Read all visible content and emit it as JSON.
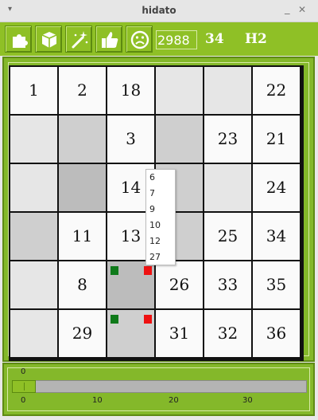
{
  "window": {
    "title": "hidato",
    "menu_glyph": "▾",
    "minimize_glyph": "_",
    "close_glyph": "✕"
  },
  "toolbar": {
    "buttons": [
      {
        "name": "puzzle-button",
        "icon": "puzzle-icon"
      },
      {
        "name": "cube-button",
        "icon": "cube-icon"
      },
      {
        "name": "magic-wand-button",
        "icon": "magic-wand-icon"
      },
      {
        "name": "thumbs-up-button",
        "icon": "thumbs-up-icon"
      },
      {
        "name": "sad-face-button",
        "icon": "sad-face-icon"
      }
    ],
    "score": "2988",
    "count": "34",
    "level": "H2"
  },
  "colors": {
    "accent": "#8fc026",
    "border_dark": "#5e8a14",
    "cell_white": "#fafafa",
    "cell_light": "#e6e6e6",
    "cell_mid": "#cfcfcf",
    "cell_dark": "#bcbcbc",
    "marker_green": "#0f7a1a",
    "marker_red": "#ee1111"
  },
  "grid": {
    "rows": [
      [
        {
          "v": "1",
          "shade": "white"
        },
        {
          "v": "2",
          "shade": "white"
        },
        {
          "v": "18",
          "shade": "white"
        },
        {
          "v": "",
          "shade": "light"
        },
        {
          "v": "",
          "shade": "light"
        },
        {
          "v": "22",
          "shade": "white"
        }
      ],
      [
        {
          "v": "",
          "shade": "light"
        },
        {
          "v": "",
          "shade": "mid"
        },
        {
          "v": "3",
          "shade": "white"
        },
        {
          "v": "",
          "shade": "mid"
        },
        {
          "v": "23",
          "shade": "white"
        },
        {
          "v": "21",
          "shade": "white"
        }
      ],
      [
        {
          "v": "",
          "shade": "light"
        },
        {
          "v": "",
          "shade": "dark"
        },
        {
          "v": "14",
          "shade": "white"
        },
        {
          "v": "",
          "shade": "mid"
        },
        {
          "v": "",
          "shade": "light"
        },
        {
          "v": "24",
          "shade": "white"
        }
      ],
      [
        {
          "v": "",
          "shade": "mid"
        },
        {
          "v": "11",
          "shade": "white"
        },
        {
          "v": "13",
          "shade": "white"
        },
        {
          "v": "",
          "shade": "mid"
        },
        {
          "v": "25",
          "shade": "white"
        },
        {
          "v": "34",
          "shade": "white"
        }
      ],
      [
        {
          "v": "",
          "shade": "light"
        },
        {
          "v": "8",
          "shade": "white"
        },
        {
          "v": "",
          "shade": "dark",
          "markers": true
        },
        {
          "v": "26",
          "shade": "white"
        },
        {
          "v": "33",
          "shade": "white"
        },
        {
          "v": "35",
          "shade": "white"
        }
      ],
      [
        {
          "v": "",
          "shade": "light"
        },
        {
          "v": "29",
          "shade": "white"
        },
        {
          "v": "",
          "shade": "mid",
          "markers": true
        },
        {
          "v": "31",
          "shade": "white"
        },
        {
          "v": "32",
          "shade": "white"
        },
        {
          "v": "36",
          "shade": "white"
        }
      ]
    ]
  },
  "popup": {
    "options": [
      "6",
      "7",
      "9",
      "10",
      "12",
      "27"
    ]
  },
  "slider": {
    "value": "0",
    "ticks": [
      "0",
      "10",
      "20",
      "30"
    ]
  }
}
